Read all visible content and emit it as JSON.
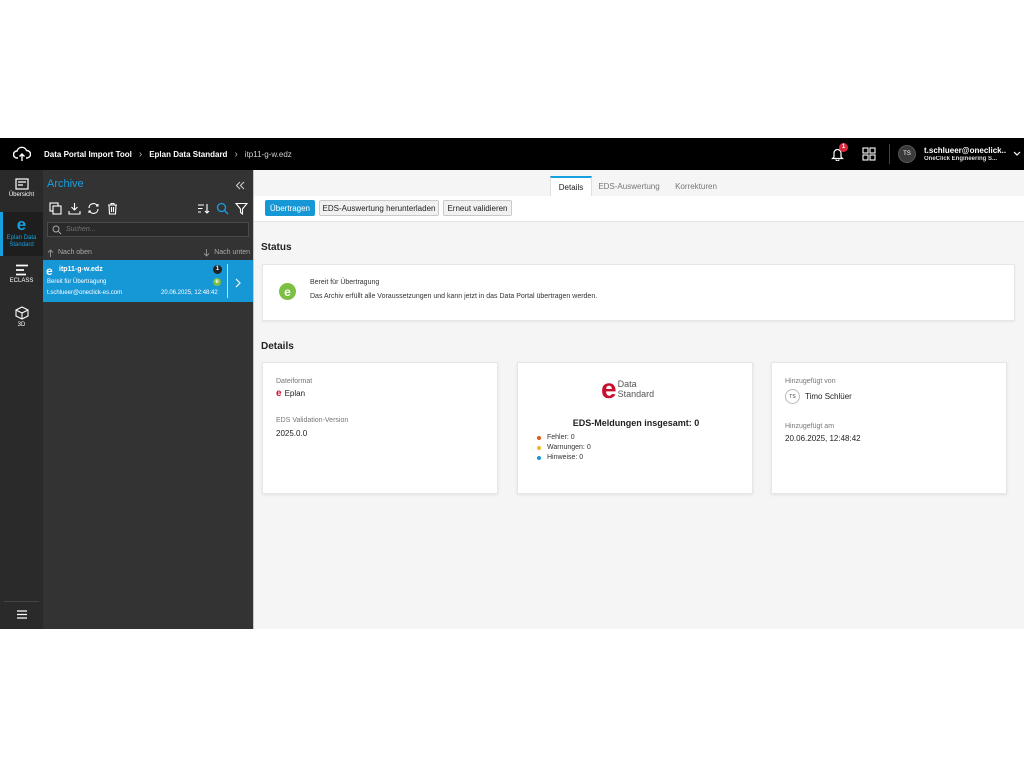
{
  "topbar": {
    "breadcrumbs": [
      "Data Portal Import Tool",
      "Eplan Data Standard",
      "itp11-g-w.edz"
    ],
    "notification_count": "1",
    "user_initials": "TS",
    "user_name": "t.schlueer@oneclick...",
    "user_org": "OneClick Engineering S..."
  },
  "rail": {
    "items": [
      {
        "label": "Übersicht",
        "icon": "overview-icon"
      },
      {
        "label": "Eplan Data Standard",
        "icon": "eplan-e-icon",
        "active": true
      },
      {
        "label": "ECLASS",
        "icon": "eclass-icon"
      },
      {
        "label": "3D",
        "icon": "cube-icon"
      }
    ]
  },
  "panel": {
    "title": "Archive",
    "search_placeholder": "Suchen...",
    "sort_up": "Nach oben",
    "sort_down": "Nach unten",
    "item": {
      "icon_letter": "e",
      "name": "itp11-g-w.edz",
      "status": "Bereit für Übertragung",
      "user": "t.schlueer@oneclick-es.com",
      "date": "20.06.2025, 12:48:42",
      "badge": "1",
      "status_letter": "e"
    }
  },
  "tabs": [
    "Details",
    "EDS-Auswertung",
    "Korrekturen"
  ],
  "actions": {
    "transfer": "Übertragen",
    "download": "EDS-Auswertung herunterladen",
    "revalidate": "Erneut validieren"
  },
  "status": {
    "heading": "Status",
    "icon_letter": "e",
    "title": "Bereit für Übertragung",
    "description": "Das Archiv erfüllt alle Voraussetzungen und kann jetzt in das Data Portal übertragen werden."
  },
  "details": {
    "heading": "Details",
    "format_label": "Dateiformat",
    "format_icon_letter": "e",
    "format_value": "Eplan",
    "version_label": "EDS Validation-Version",
    "version_value": "2025.0.0",
    "eds_logo_letter": "e",
    "eds_logo_line1": "Data",
    "eds_logo_line2": "Standard",
    "eds_total": "EDS-Meldungen insgesamt: 0",
    "errors": "Fehler: 0",
    "warnings": "Warnungen: 0",
    "hints": "Hinweise: 0",
    "added_by_label": "Hinzugefügt von",
    "added_by_initials": "TS",
    "added_by_name": "Timo Schlüer",
    "added_on_label": "Hinzugefügt am",
    "added_on_value": "20.06.2025, 12:48:42"
  },
  "colors": {
    "accent": "#1798d6",
    "success": "#7bc043",
    "error_dot": "#e05a1b",
    "warning_dot": "#f0b429",
    "hint_dot": "#1798d6",
    "eplan_red": "#c8102e"
  }
}
